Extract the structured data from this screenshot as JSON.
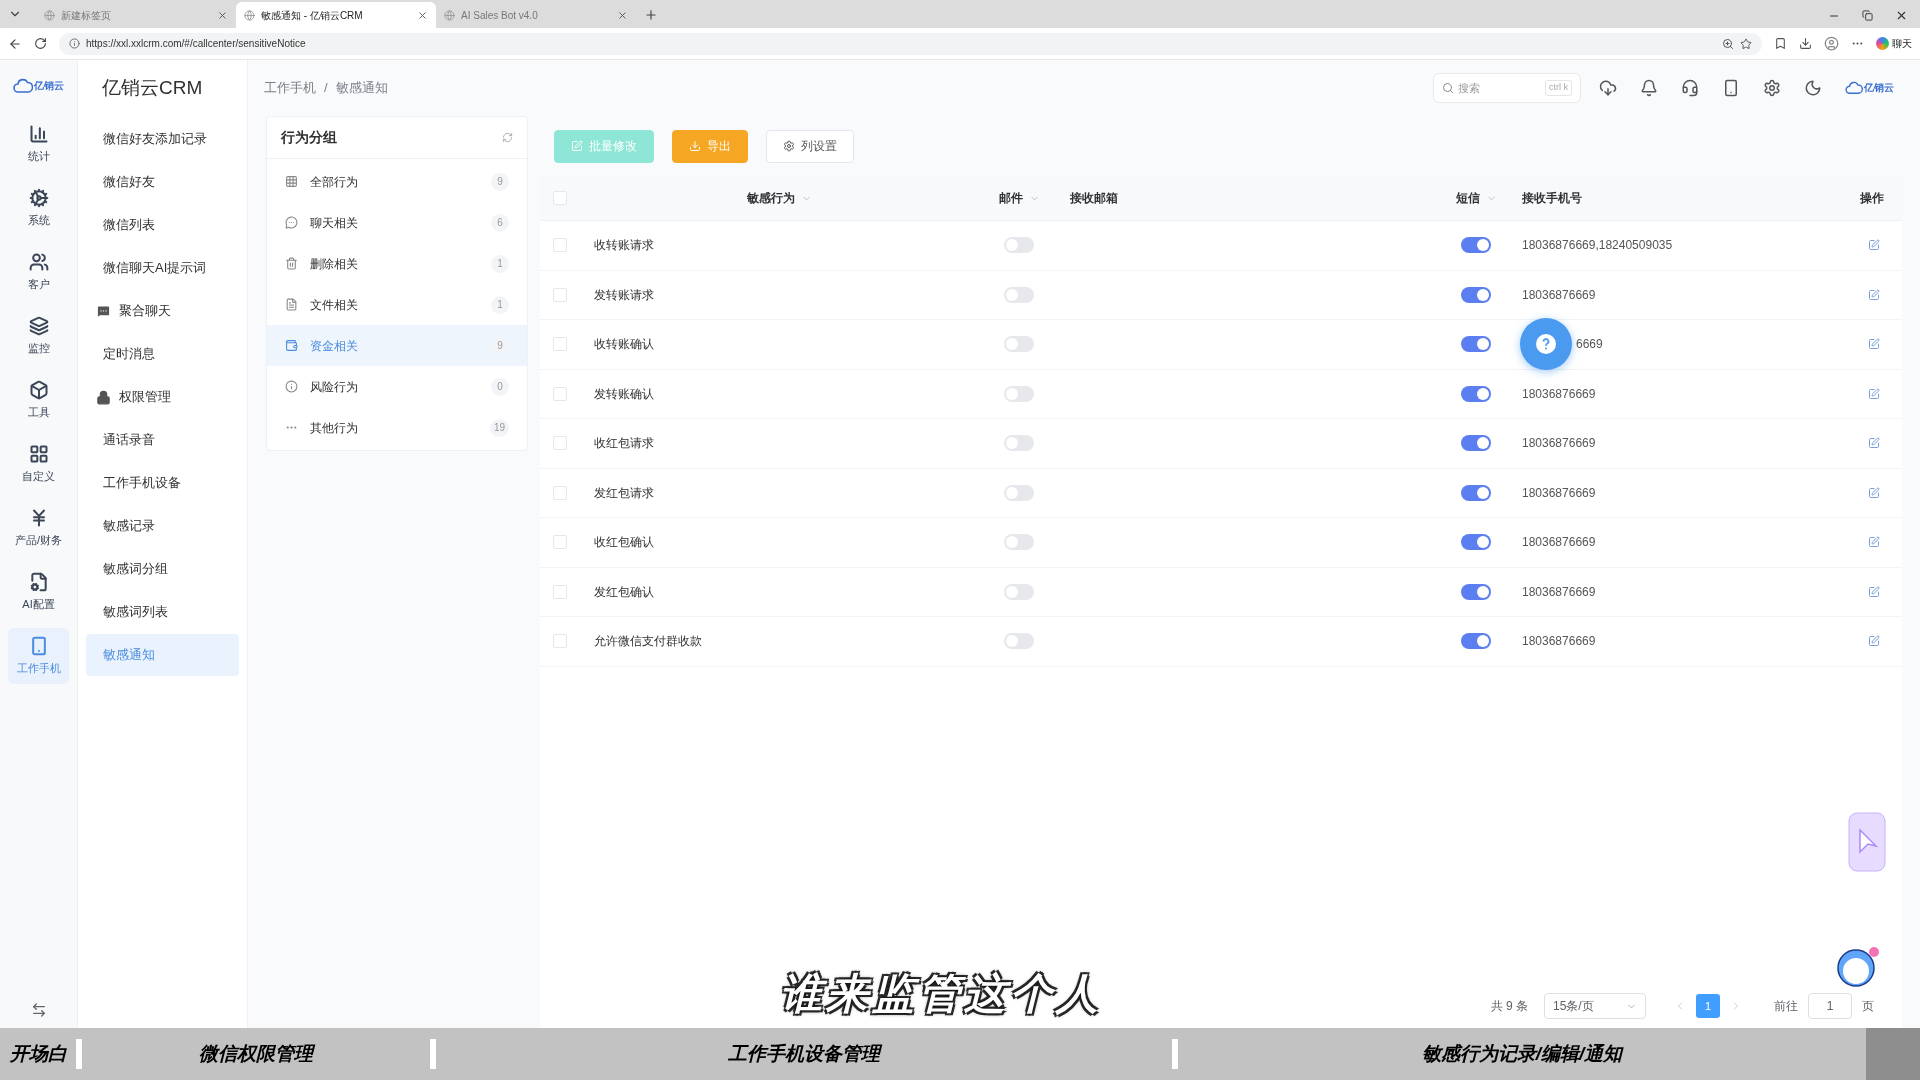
{
  "browser": {
    "tabs": [
      {
        "title": "新建标签页",
        "selected": false
      },
      {
        "title": "敏感通知 - 亿销云CRM",
        "selected": true
      },
      {
        "title": "AI Sales Bot v4.0",
        "selected": false
      }
    ],
    "url": "https://xxl.xxlcrm.com/#/callcenter/sensitiveNotice",
    "chat_button": "聊天"
  },
  "logo_text_rail": "亿销云",
  "logo_text_header": "亿销云",
  "rail": [
    {
      "kind": "stats",
      "label": "统计",
      "selected": false
    },
    {
      "kind": "system",
      "label": "系统",
      "selected": false
    },
    {
      "kind": "customers",
      "label": "客户",
      "selected": false
    },
    {
      "kind": "monitor",
      "label": "监控",
      "selected": false
    },
    {
      "kind": "tools",
      "label": "工具",
      "selected": false
    },
    {
      "kind": "custom",
      "label": "自定义",
      "selected": false
    },
    {
      "kind": "finance",
      "label": "产品/财务",
      "selected": false
    },
    {
      "kind": "ai",
      "label": "AI配置",
      "selected": false
    },
    {
      "kind": "phone",
      "label": "工作手机",
      "selected": true
    }
  ],
  "app_title": "亿销云CRM",
  "menu": [
    {
      "kind": "plain",
      "label": "微信好友添加记录",
      "selected": false
    },
    {
      "kind": "plain",
      "label": "微信好友",
      "selected": false
    },
    {
      "kind": "plain",
      "label": "微信列表",
      "selected": false
    },
    {
      "kind": "plain",
      "label": "微信聊天AI提示词",
      "selected": false
    },
    {
      "kind": "chat",
      "label": "聚合聊天",
      "selected": false
    },
    {
      "kind": "plain",
      "label": "定时消息",
      "selected": false
    },
    {
      "kind": "lock",
      "label": "权限管理",
      "selected": false
    },
    {
      "kind": "plain",
      "label": "通话录音",
      "selected": false
    },
    {
      "kind": "plain",
      "label": "工作手机设备",
      "selected": false
    },
    {
      "kind": "plain",
      "label": "敏感记录",
      "selected": false
    },
    {
      "kind": "plain",
      "label": "敏感词分组",
      "selected": false
    },
    {
      "kind": "plain",
      "label": "敏感词列表",
      "selected": false
    },
    {
      "kind": "plain",
      "label": "敏感通知",
      "selected": true
    }
  ],
  "breadcrumb": [
    "工作手机",
    "敏感通知"
  ],
  "breadcrumb_separator": "/",
  "search": {
    "placeholder": "搜索",
    "shortcut": "ctrl k"
  },
  "groups": {
    "title": "行为分组",
    "items": [
      {
        "kind": "all",
        "label": "全部行为",
        "count": "9",
        "selected": false
      },
      {
        "kind": "chat",
        "label": "聊天相关",
        "count": "6",
        "selected": false
      },
      {
        "kind": "delete",
        "label": "删除相关",
        "count": "1",
        "selected": false
      },
      {
        "kind": "file",
        "label": "文件相关",
        "count": "1",
        "selected": false
      },
      {
        "kind": "money",
        "label": "资金相关",
        "count": "9",
        "selected": true
      },
      {
        "kind": "risk",
        "label": "风险行为",
        "count": "0",
        "selected": false
      },
      {
        "kind": "other",
        "label": "其他行为",
        "count": "19",
        "selected": false
      }
    ]
  },
  "toolbar": [
    {
      "kind": "batch",
      "label": "批量修改",
      "disabled": true
    },
    {
      "kind": "export",
      "label": "导出",
      "disabled": false
    },
    {
      "kind": "columns",
      "label": "列设置",
      "disabled": false
    }
  ],
  "table": {
    "all_checked": false,
    "columns": [
      {
        "label": "敏感行为",
        "filter": true
      },
      {
        "label": "邮件",
        "filter": true
      },
      {
        "label": "接收邮箱",
        "filter": false
      },
      {
        "label": "短信",
        "filter": true
      },
      {
        "label": "接收手机号",
        "filter": false
      },
      {
        "label": "操作",
        "filter": false
      }
    ],
    "rows": [
      {
        "checked": false,
        "behavior": "收转账请求",
        "email_on": false,
        "sms_on": true,
        "phone": "18036876669,18240509035",
        "covered": false
      },
      {
        "checked": false,
        "behavior": "发转账请求",
        "email_on": false,
        "sms_on": true,
        "phone": "18036876669",
        "covered": false
      },
      {
        "checked": false,
        "behavior": "收转账确认",
        "email_on": false,
        "sms_on": true,
        "phone": "6669",
        "covered": true
      },
      {
        "checked": false,
        "behavior": "发转账确认",
        "email_on": false,
        "sms_on": true,
        "phone": "18036876669",
        "covered": false
      },
      {
        "checked": false,
        "behavior": "收红包请求",
        "email_on": false,
        "sms_on": true,
        "phone": "18036876669",
        "covered": false
      },
      {
        "checked": false,
        "behavior": "发红包请求",
        "email_on": false,
        "sms_on": true,
        "phone": "18036876669",
        "covered": false
      },
      {
        "checked": false,
        "behavior": "收红包确认",
        "email_on": false,
        "sms_on": true,
        "phone": "18036876669",
        "covered": false
      },
      {
        "checked": false,
        "behavior": "发红包确认",
        "email_on": false,
        "sms_on": true,
        "phone": "18036876669",
        "covered": false
      },
      {
        "checked": false,
        "behavior": "允许微信支付群收款",
        "email_on": false,
        "sms_on": true,
        "phone": "18036876669",
        "covered": false
      }
    ]
  },
  "pagination": {
    "total": "共 9 条",
    "page_size": "15条/页",
    "pages": [
      {
        "label": "1",
        "selected": true
      }
    ],
    "goto_label": "前往",
    "goto_value": "1",
    "suffix": "页"
  },
  "subtitle": "谁来监管这个人",
  "chapters": [
    {
      "label": "开场白"
    },
    {
      "label": "微信权限管理"
    },
    {
      "label": "工作手机设备管理"
    },
    {
      "label": "敏感行为记录/编辑/通知"
    }
  ]
}
